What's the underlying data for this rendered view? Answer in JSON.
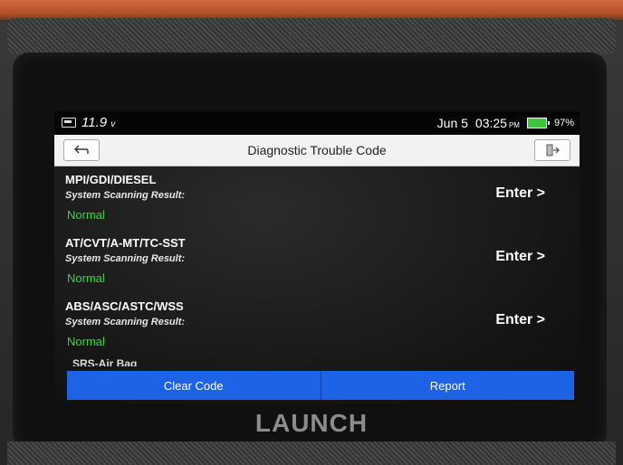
{
  "status_bar": {
    "voltage": "11.9",
    "voltage_unit": "v",
    "date": "Jun 5",
    "time": "03:25",
    "ampm": "PM",
    "battery_percent": "97%"
  },
  "header": {
    "title": "Diagnostic Trouble Code"
  },
  "systems": [
    {
      "name": "MPI/GDI/DIESEL",
      "scan_label": "System Scanning Result:",
      "result": "Normal",
      "action": "Enter >"
    },
    {
      "name": "AT/CVT/A-MT/TC-SST",
      "scan_label": "System Scanning Result:",
      "result": "Normal",
      "action": "Enter >"
    },
    {
      "name": "ABS/ASC/ASTC/WSS",
      "scan_label": "System Scanning Result:",
      "result": "Normal",
      "action": "Enter >"
    }
  ],
  "partial_item": "SRS-Air Bag",
  "footer": {
    "clear_code": "Clear Code",
    "report": "Report"
  },
  "brand": "LAUNCH",
  "colors": {
    "accent": "#1e63e6",
    "normal": "#3fd24a",
    "battery": "#3ec53e"
  }
}
